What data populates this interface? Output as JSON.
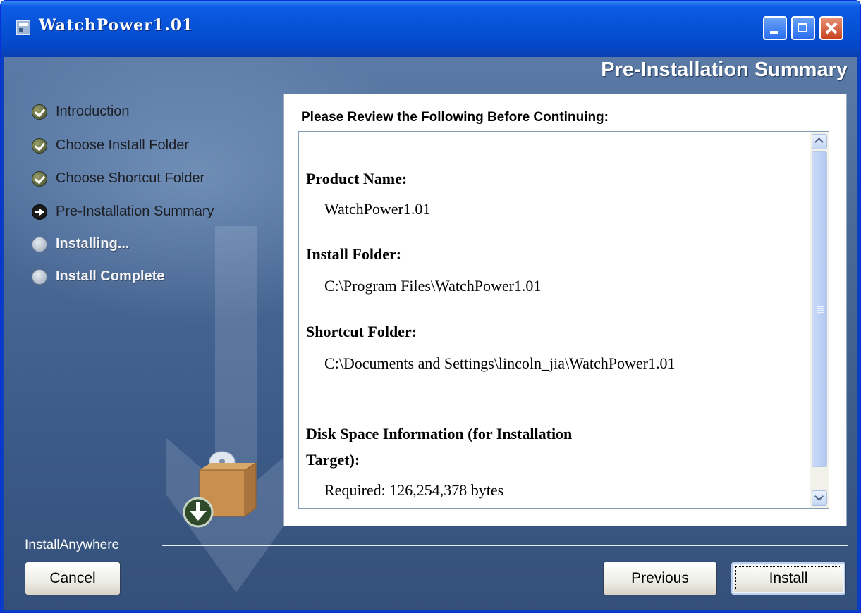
{
  "window": {
    "title": "WatchPower1.01"
  },
  "header": {
    "step_title": "Pre-Installation Summary"
  },
  "steps": [
    {
      "label": "Introduction",
      "status": "done"
    },
    {
      "label": "Choose Install Folder",
      "status": "done"
    },
    {
      "label": "Choose Shortcut Folder",
      "status": "done"
    },
    {
      "label": "Pre-Installation Summary",
      "status": "current"
    },
    {
      "label": "Installing...",
      "status": "pending"
    },
    {
      "label": "Install Complete",
      "status": "pending"
    }
  ],
  "summary": {
    "heading": "Please Review the Following Before Continuing:",
    "product_name_label": "Product Name:",
    "product_name_value": "WatchPower1.01",
    "install_folder_label": "Install Folder:",
    "install_folder_value": "C:\\Program Files\\WatchPower1.01",
    "shortcut_folder_label": "Shortcut Folder:",
    "shortcut_folder_value": "C:\\Documents and Settings\\lincoln_jia\\WatchPower1.01",
    "disk_space_label_line1": "Disk Space Information (for Installation",
    "disk_space_label_line2": "Target):",
    "disk_space_value": "Required: 126,254,378 bytes"
  },
  "footer": {
    "brand": "InstallAnywhere",
    "cancel_label": "Cancel",
    "previous_label": "Previous",
    "install_label": "Install"
  },
  "icons": {
    "window_icon": "app-icon",
    "step_done": "checkmark-icon",
    "step_current": "arrow-right-icon",
    "step_pending": "circle-icon"
  },
  "colors": {
    "titlebar": "#0653d8",
    "content_bg": "#4b6a96",
    "panel_bg": "#ffffff",
    "accent_close": "#c8431f"
  }
}
